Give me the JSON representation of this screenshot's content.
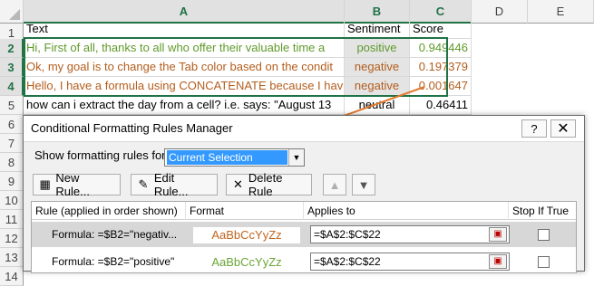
{
  "columns": [
    "A",
    "B",
    "C",
    "D",
    "E"
  ],
  "rows": [
    "1",
    "2",
    "3",
    "4",
    "5",
    "6",
    "7",
    "8",
    "9",
    "10",
    "11",
    "12",
    "13",
    "14"
  ],
  "headers": {
    "text": "Text",
    "sentiment": "Sentiment",
    "score": "Score"
  },
  "data": [
    {
      "text": "Hi, First of all, thanks to all who offer their valuable time a",
      "sentiment": "positive",
      "score": "0.949446",
      "style": "pos"
    },
    {
      "text": "Ok, my goal is to change the Tab color based on the condit",
      "sentiment": "negative",
      "score": "0.197379",
      "style": "neg"
    },
    {
      "text": "Hello, I have a formula using CONCATENATE because I hav",
      "sentiment": "negative",
      "score": "0.001647",
      "style": "neg"
    },
    {
      "text": "how can i extract the day from a cell?  i.e. says: \"August 13",
      "sentiment": "neutral",
      "score": "0.46411",
      "style": "none"
    }
  ],
  "dialog": {
    "title": "Conditional Formatting Rules Manager",
    "help_label": "?",
    "close_label": "✕",
    "show_rules_label": "Show formatting rules for:",
    "show_rules_value": "Current Selection",
    "buttons": {
      "new_rule": "New Rule...",
      "edit_rule": "Edit Rule...",
      "delete_rule": "Delete Rule"
    },
    "list_headers": {
      "rule": "Rule (applied in order shown)",
      "format": "Format",
      "applies_to": "Applies to",
      "stop_if_true": "Stop If True"
    },
    "rules": [
      {
        "rule": "Formula: =$B2=\"negativ...",
        "format_preview": "AaBbCcYyZz",
        "applies_to": "=$A$2:$C$22",
        "color": "#c0651f",
        "selected": true
      },
      {
        "rule": "Formula: =$B2=\"positive\"",
        "format_preview": "AaBbCcYyZz",
        "applies_to": "=$A$2:$C$22",
        "color": "#6aa535",
        "selected": false
      }
    ]
  },
  "colors": {
    "positive_text": "#5f9a2a",
    "negative_text": "#b35d1c",
    "excel_green": "#217346",
    "selection_blue": "#3399ff",
    "annotation_arrow": "#e07a2e"
  }
}
